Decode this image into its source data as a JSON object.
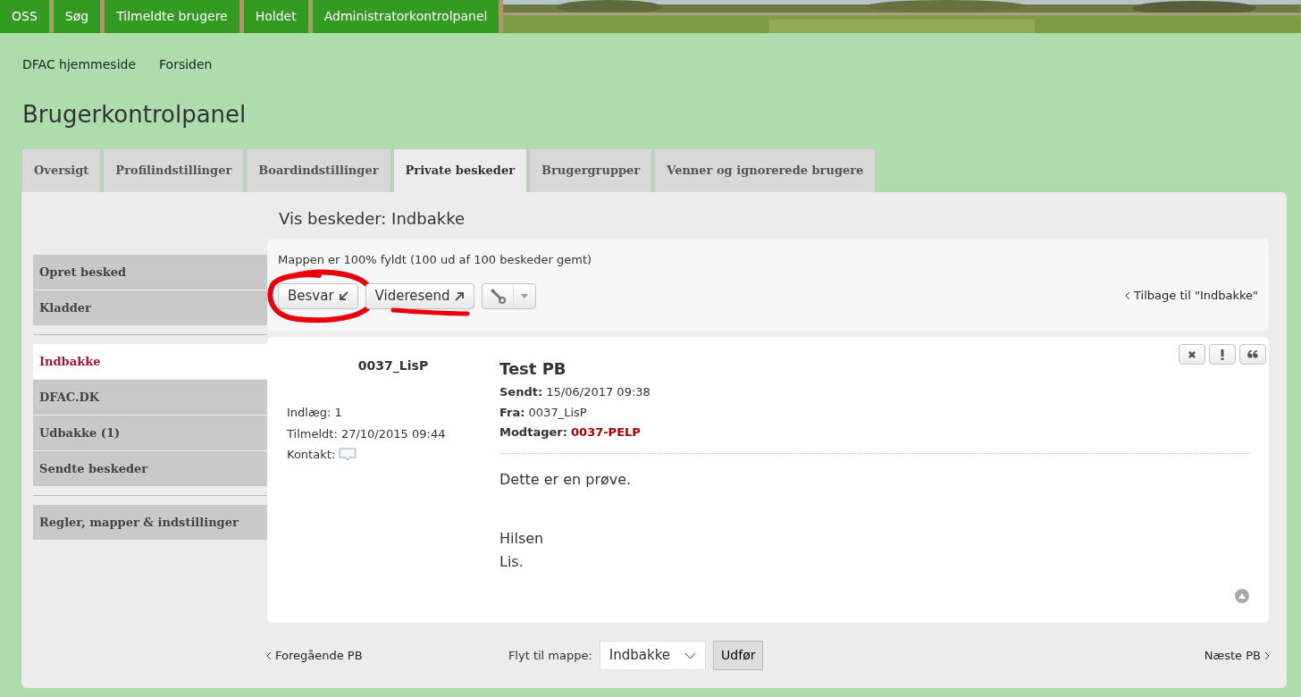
{
  "nav": {
    "items": [
      "OSS",
      "Søg",
      "Tilmeldte brugere",
      "Holdet",
      "Administratorkontrolpanel"
    ]
  },
  "breadcrumbs": [
    "DFAC hjemmeside",
    "Forsiden"
  ],
  "title": "Brugerkontrolpanel",
  "tabs": [
    {
      "label": "Oversigt",
      "selected": false
    },
    {
      "label": "Profilindstillinger",
      "selected": false
    },
    {
      "label": "Boardindstillinger",
      "selected": false
    },
    {
      "label": "Private beskeder",
      "selected": true
    },
    {
      "label": "Brugergrupper",
      "selected": false
    },
    {
      "label": "Venner og ignorerede brugere",
      "selected": false
    }
  ],
  "sidebar": {
    "groups": [
      {
        "items": [
          {
            "label": "Opret besked",
            "selected": false
          },
          {
            "label": "Kladder",
            "selected": false
          }
        ]
      },
      {
        "items": [
          {
            "label": "Indbakke",
            "selected": true
          },
          {
            "label": "DFAC.DK",
            "selected": false
          },
          {
            "label": "Udbakke (1)",
            "selected": false
          },
          {
            "label": "Sendte beskeder",
            "selected": false
          }
        ]
      },
      {
        "items": [
          {
            "label": "Regler, mapper & indstillinger",
            "selected": false
          }
        ]
      }
    ]
  },
  "content": {
    "heading": "Vis beskeder: Indbakke",
    "toolbar": {
      "status": "Mappen er 100% fyldt (100 ud af 100 beskeder gemt)",
      "buttons": [
        {
          "kind": "reply",
          "label": "Besvar",
          "circled": true,
          "underlined": false
        },
        {
          "kind": "forward",
          "label": "Videresend",
          "circled": false,
          "underlined": true
        },
        {
          "kind": "tools"
        }
      ],
      "back_link": "Tilbage til \"Indbakke\""
    },
    "message": {
      "author": {
        "name": "0037_LisP",
        "details": [
          "Indlæg: 1",
          "Tilmeldt: 27/10/2015 09:44"
        ],
        "contact_label": "Kontakt:"
      },
      "subject": "Test PB",
      "meta": [
        {
          "kind": "plain",
          "label": "Sendt:",
          "value": "15/06/2017 09:38"
        },
        {
          "kind": "plain",
          "label": "Fra:",
          "value": "0037_LisP"
        },
        {
          "kind": "recipient",
          "label": "Modtager:",
          "value": "0037-PELP"
        }
      ],
      "body": [
        {
          "lines": [
            "Dette er en prøve."
          ]
        },
        {
          "lines": [
            "Hilsen",
            "Lis."
          ]
        }
      ]
    },
    "footer": {
      "prev": "Foregående PB",
      "move_label": "Flyt til mappe:",
      "folder": "Indbakke",
      "submit": "Udfør",
      "next": "Næste PB"
    }
  }
}
